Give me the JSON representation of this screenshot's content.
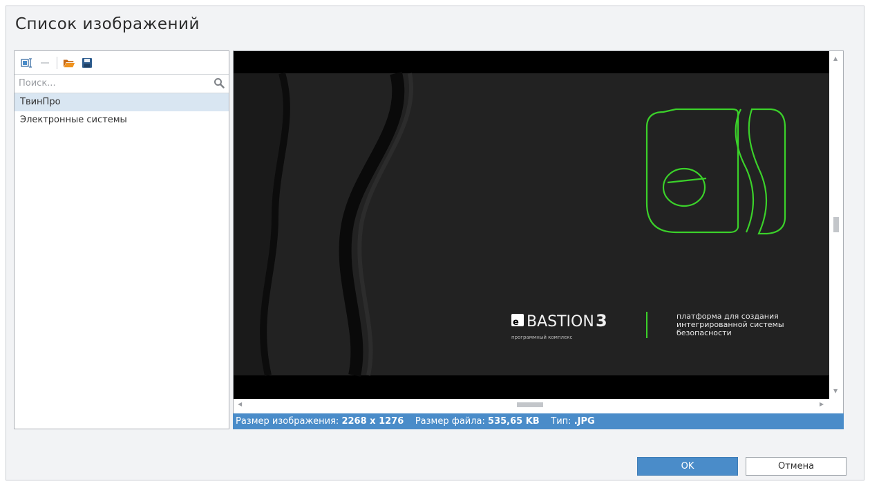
{
  "dialog": {
    "title": "Список изображений"
  },
  "toolbar": {
    "buttons": [
      {
        "icon": "rename-icon"
      },
      {
        "icon": "remove-icon"
      },
      {
        "icon": "folder-open-icon"
      },
      {
        "icon": "save-icon"
      }
    ]
  },
  "search": {
    "placeholder": "Поиск...",
    "value": ""
  },
  "image_list": {
    "items": [
      {
        "label": "ТвинПро",
        "selected": true
      },
      {
        "label": "Электронные системы",
        "selected": false
      }
    ]
  },
  "preview": {
    "logo_word": "BASTION",
    "logo_number": "3",
    "logo_sub": "программный комплекс",
    "tagline_1": "платформа для создания",
    "tagline_2": "интегрированной системы",
    "tagline_3": "безопасности",
    "colors": {
      "accent": "#3bd12a",
      "background": "#1f1f1f"
    }
  },
  "status": {
    "size_label": "Размер изображения:",
    "size_value": "2268 x 1276",
    "file_label": "Размер файла:",
    "file_value": "535,65 KB",
    "type_label": "Тип:",
    "type_value": ".JPG"
  },
  "buttons": {
    "ok": "OK",
    "cancel": "Отмена"
  },
  "colors": {
    "accent": "#4a8cc9",
    "selected_row": "#d9e6f2"
  }
}
